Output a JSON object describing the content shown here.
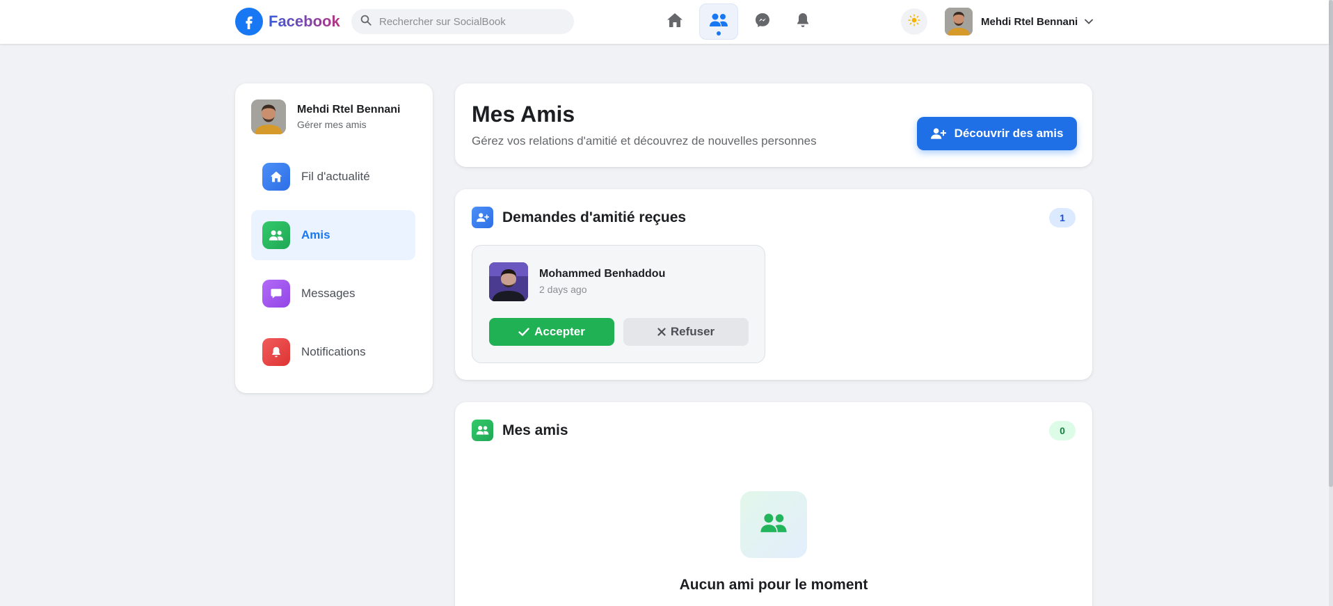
{
  "topbar": {
    "brand": "Facebook",
    "search_placeholder": "Rechercher sur SocialBook",
    "user_name": "Mehdi Rtel Bennani",
    "nav_icons": [
      "home-icon",
      "friends-icon",
      "messenger-icon",
      "bell-icon"
    ],
    "active_nav": "friends-icon"
  },
  "sidebar": {
    "profile_name": "Mehdi Rtel Bennani",
    "profile_sub": "Gérer mes amis",
    "items": [
      {
        "label": "Fil d'actualité",
        "icon": "home-icon",
        "color": "#3b82f6",
        "active": false
      },
      {
        "label": "Amis",
        "icon": "friends-icon",
        "color": "#22c55e",
        "active": true
      },
      {
        "label": "Messages",
        "icon": "message-icon",
        "color": "#a855f7",
        "active": false
      },
      {
        "label": "Notifications",
        "icon": "bell-icon",
        "color": "#ef4444",
        "active": false
      }
    ]
  },
  "header": {
    "title": "Mes Amis",
    "subtitle": "Gérez vos relations d'amitié et découvrez de nouvelles personnes",
    "discover_label": "Découvrir des amis"
  },
  "requests": {
    "title": "Demandes d'amitié reçues",
    "count": "1",
    "items": [
      {
        "name": "Mohammed Benhaddou",
        "time": "2 days ago",
        "accept_label": "Accepter",
        "refuse_label": "Refuser"
      }
    ]
  },
  "friends": {
    "title": "Mes amis",
    "count": "0",
    "empty_title": "Aucun ami pour le moment"
  },
  "colors": {
    "accent": "#1877f2",
    "accept": "#1fb154",
    "badge_blue_bg": "#dbeafe",
    "badge_blue_text": "#1d4ed8",
    "badge_green_bg": "#dcfce7",
    "badge_green_text": "#15803d"
  }
}
